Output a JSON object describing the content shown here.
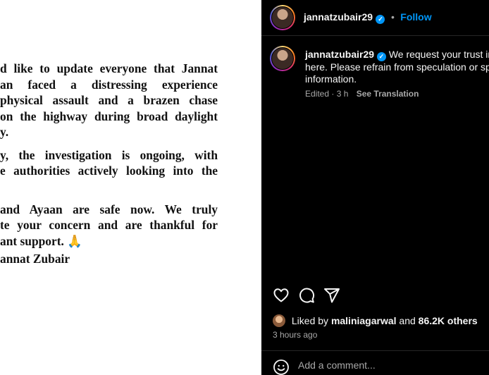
{
  "statement": {
    "lines": [
      "d like to update everyone that Jannat",
      "an faced a distressing experience",
      "physical assault and a brazen chase",
      "on the highway during broad daylight",
      "y.",
      "",
      "y, the investigation is ongoing, with",
      "e authorities actively looking into the",
      "",
      "",
      "and Ayaan are safe now. We truly",
      "te your concern and are thankful for",
      "ant support. 🙏",
      "",
      "annat Zubair"
    ]
  },
  "post": {
    "author": "jannatzubair29",
    "follow_label": "Follow",
    "separator": "•",
    "caption_username": "jannatzubair29",
    "caption_lines": [
      "We request your trust in t",
      "here. Please refrain from speculation or spre",
      "information."
    ],
    "edited": "Edited · 3 h",
    "see_translation": "See Translation",
    "liked_by_prefix": "Liked by",
    "liked_by_user": "maliniagarwal",
    "liked_by_and": "and",
    "liked_by_others": "86.2K others",
    "time_ago": "3 hours ago",
    "comment_placeholder": "Add a comment...",
    "verified_mark": "✓"
  },
  "colors": {
    "background": "#000000",
    "link_blue": "#0095f6",
    "secondary_text": "#a8a8a8"
  },
  "icons": [
    "heart-icon",
    "comment-icon",
    "share-icon",
    "emoji-icon",
    "verified-badge-icon"
  ]
}
